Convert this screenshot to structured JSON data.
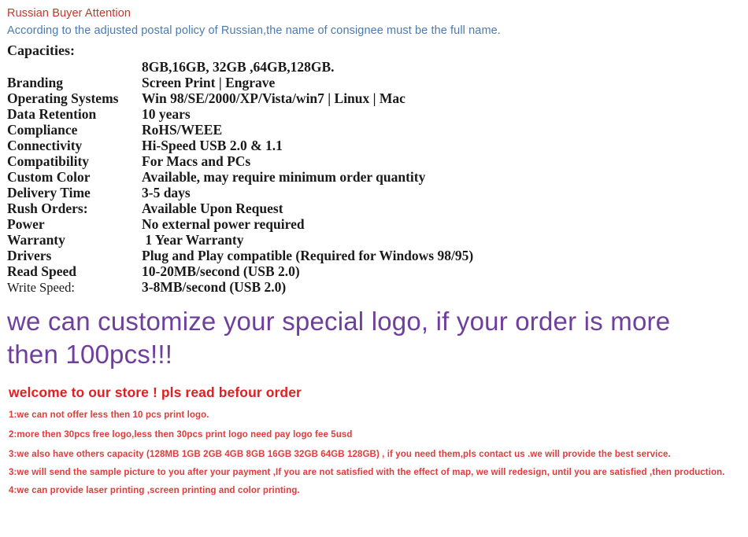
{
  "notice": {
    "title": "Russian Buyer Attention",
    "body": "According to the adjusted postal policy of Russian,the name of consignee must be the full name.",
    "title_color": "#c0392b",
    "body_color": "#4a7ab0"
  },
  "spec": {
    "heading": "Capacities:",
    "capacities_value": "8GB,16GB, 32GB ,64GB,128GB.",
    "rows": [
      {
        "label": "Branding",
        "value": "Screen Print | Engrave"
      },
      {
        "label": "Operating Systems",
        "value": "Win 98/SE/2000/XP/Vista/win7 | Linux | Mac"
      },
      {
        "label": "Data Retention",
        "value": "10 years"
      },
      {
        "label": "Compliance",
        "value": "RoHS/WEEE"
      },
      {
        "label": "Connectivity",
        "value": "Hi-Speed USB 2.0 & 1.1"
      },
      {
        "label": "Compatibility",
        "value": "For Macs and PCs"
      },
      {
        "label": "Custom Color",
        "value": "Available, may require minimum order quantity"
      },
      {
        "label": "Delivery Time",
        "value": "3-5 days"
      },
      {
        "label": "Rush Orders:",
        "value": "Available Upon Request"
      },
      {
        "label": "Power",
        "value": "No external power required"
      },
      {
        "label": "Warranty",
        "value": " 1 Year Warranty"
      },
      {
        "label": "Drivers",
        "value": "Plug and Play compatible (Required for Windows 98/95)"
      },
      {
        "label": "Read Speed",
        "value": "10-20MB/second (USB 2.0)"
      },
      {
        "label": "Write Speed:",
        "value": "3-8MB/second (USB 2.0)"
      }
    ]
  },
  "promo": {
    "text": "we can customize your special logo, if your order is more then 100pcs!!!",
    "color": "#6f3f9e"
  },
  "store": {
    "title": "welcome to our store ! pls read befour order",
    "title_color": "#e02020",
    "line_color": "#e23b3b",
    "lines": [
      "1:we can not offer less then 10 pcs print logo.",
      "2:more then 30pcs free logo,less then 30pcs print logo need pay logo fee 5usd",
      "3:we also have others capacity (128MB 1GB 2GB 4GB 8GB 16GB 32GB 64GB 128GB) , if you need them,pls contact us .we will provide the best service.",
      "3:we will send the sample picture to you after your payment ,If you are not satisfied with the effect of map, we will redesign, until you are satisfied ,then production.",
      "4:we can provide laser printing ,screen printing and color printing."
    ]
  }
}
